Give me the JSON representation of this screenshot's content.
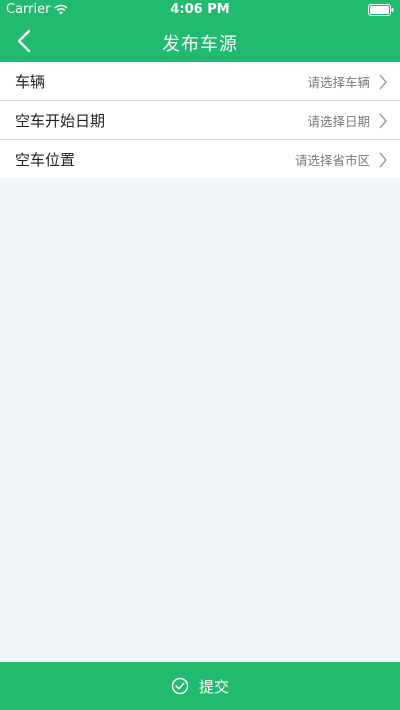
{
  "status_bar": {
    "carrier": "Carrier",
    "time": "4:06 PM",
    "wifi_icon": "wifi-icon",
    "battery_icon": "battery-icon"
  },
  "nav": {
    "title": "发布车源",
    "back_icon": "chevron-left-icon"
  },
  "form": {
    "rows": [
      {
        "label": "车辆",
        "placeholder": "请选择车辆"
      },
      {
        "label": "空车开始日期",
        "placeholder": "请选择日期"
      },
      {
        "label": "空车位置",
        "placeholder": "请选择省市区"
      }
    ]
  },
  "submit": {
    "label": "提交",
    "icon": "check-circle-icon"
  },
  "colors": {
    "accent": "#21bb70",
    "background": "#eff4f9"
  }
}
